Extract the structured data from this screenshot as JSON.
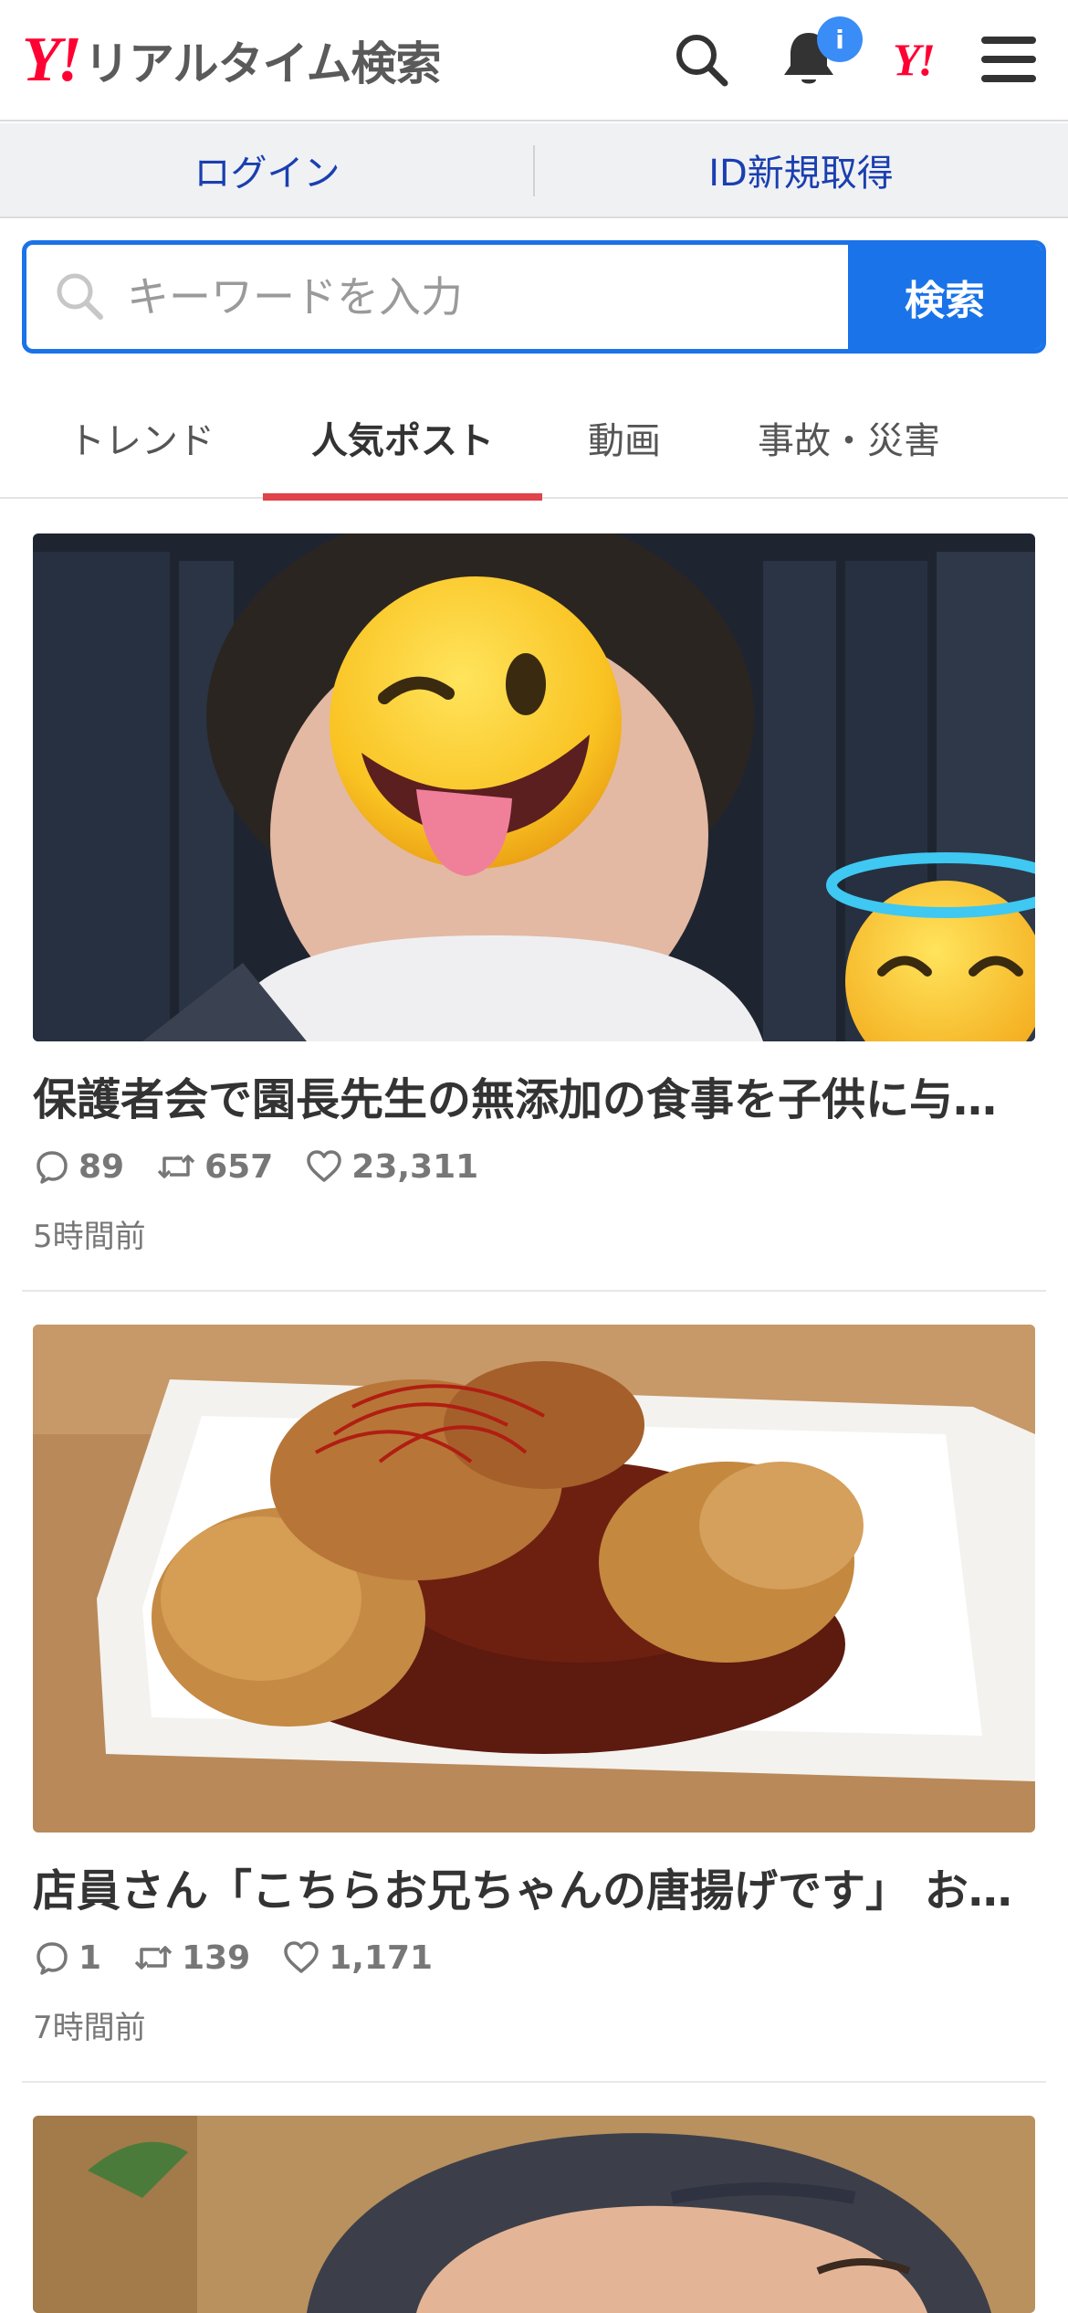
{
  "header": {
    "logo_mark": "Y!",
    "logo_text": "リアルタイム検索",
    "notification_badge": "i",
    "yj_mark": "Y!"
  },
  "account": {
    "login_label": "ログイン",
    "register_label": "ID新規取得"
  },
  "search": {
    "placeholder": "キーワードを入力",
    "button_label": "検索"
  },
  "tabs": [
    {
      "label": "トレンド",
      "active": false
    },
    {
      "label": "人気ポスト",
      "active": true
    },
    {
      "label": "動画",
      "active": false
    },
    {
      "label": "事故・災害",
      "active": false
    }
  ],
  "posts": [
    {
      "title": "保護者会で園長先生の無添加の食事を子供に与えてください",
      "replies": "89",
      "reposts": "657",
      "likes": "23,311",
      "time": "5時間前"
    },
    {
      "title": "店員さん「こちらお兄ちゃんの唐揚げです」 お子様用",
      "replies": "1",
      "reposts": "139",
      "likes": "1,171",
      "time": "7時間前"
    }
  ],
  "colors": {
    "brand_red": "#ff0033",
    "accent_blue": "#1a73e8",
    "tab_underline": "#e0434b",
    "badge_blue": "#3a8cf7"
  },
  "icons": [
    "search-icon",
    "bell-icon",
    "menu-icon",
    "reply-icon",
    "repost-icon",
    "like-icon"
  ]
}
